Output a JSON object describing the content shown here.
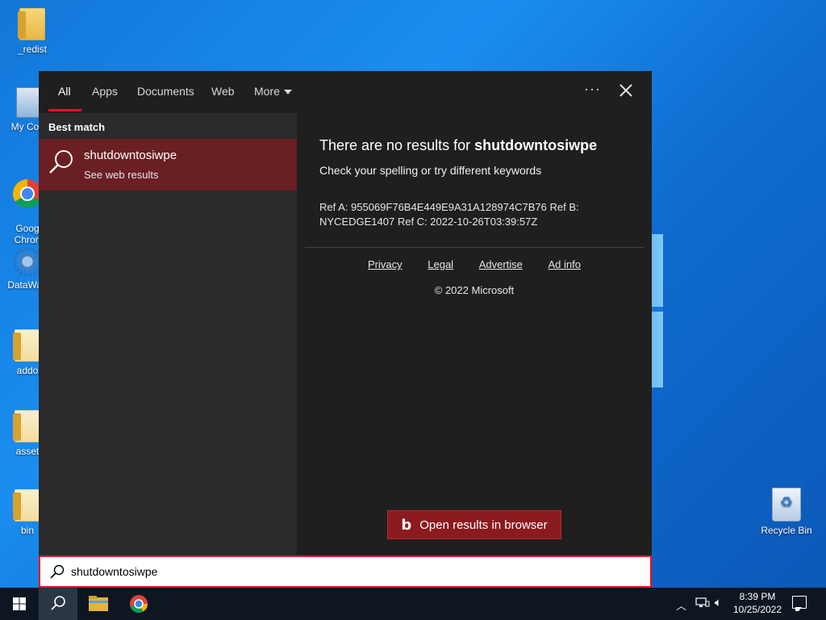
{
  "desktop": {
    "icons": [
      {
        "label": "_redist"
      },
      {
        "label": "My Com"
      },
      {
        "label": "Goog\nChron"
      },
      {
        "label": "DataWag"
      },
      {
        "label": "addo"
      },
      {
        "label": "asset"
      },
      {
        "label": "bin"
      }
    ],
    "recycle_bin": "Recycle Bin"
  },
  "search": {
    "tabs": [
      {
        "label": "All",
        "active": true
      },
      {
        "label": "Apps"
      },
      {
        "label": "Documents"
      },
      {
        "label": "Web"
      },
      {
        "label": "More"
      }
    ],
    "more_menu_icon": "ellipsis-icon",
    "best_match_label": "Best match",
    "best_match": {
      "title": "shutdowntosiwpe",
      "subtitle": "See web results"
    },
    "results": {
      "no_results_prefix": "There are no results for",
      "query": "shutdowntosiwpe",
      "hint": "Check your spelling or try different keywords",
      "refs": "Ref A: 955069F76B4E449E9A31A128974C7B76 Ref B: NYCEDGE1407 Ref C: 2022-10-26T03:39:57Z",
      "links": [
        "Privacy",
        "Legal",
        "Advertise",
        "Ad info"
      ],
      "copyright": "© 2022 Microsoft",
      "open_button": "Open results in browser"
    },
    "input_value": "shutdowntosiwpe"
  },
  "taskbar": {
    "time": "8:39 PM",
    "date": "10/25/2022"
  },
  "colors": {
    "accent": "#e81123",
    "best_match_bg": "#6a1f23",
    "button_bg": "#8b1a1f"
  }
}
